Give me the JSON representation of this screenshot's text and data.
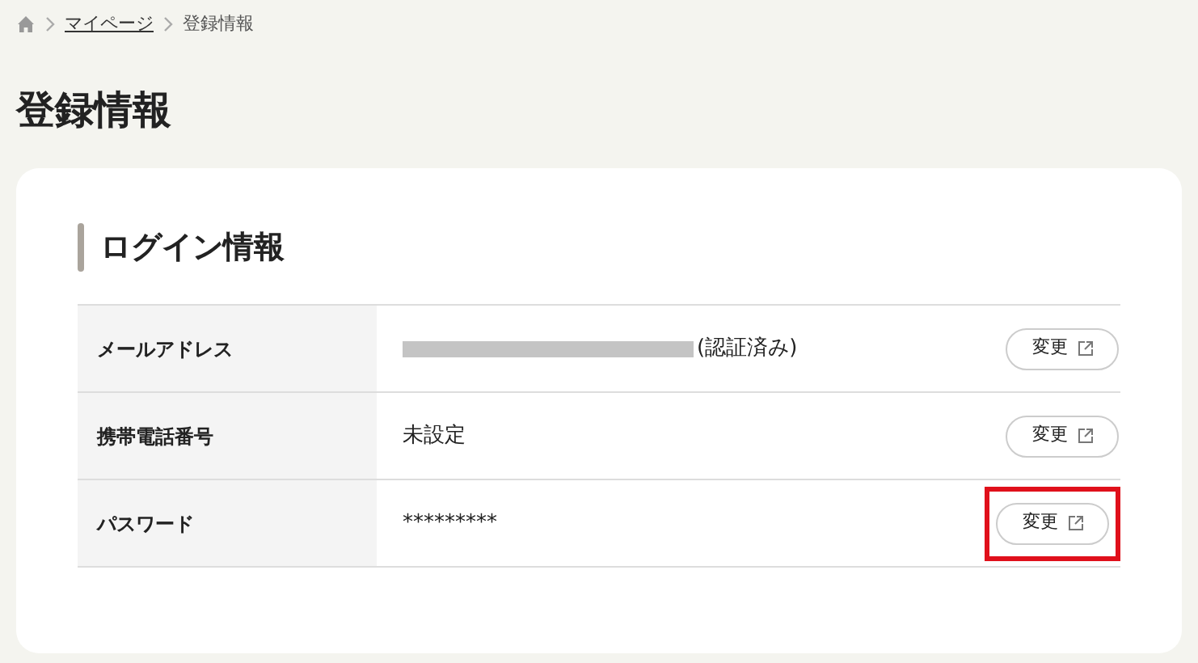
{
  "breadcrumb": [
    {
      "label": "マイページ",
      "link": true
    },
    {
      "label": "登録情報",
      "link": false
    }
  ],
  "title": "登録情報",
  "section": {
    "heading": "ログイン情報",
    "rows": [
      {
        "label": "メールアドレス",
        "value": "(認証済み)",
        "redacted": true,
        "button": "変更",
        "highlighted": false
      },
      {
        "label": "携帯電話番号",
        "value": "未設定",
        "redacted": false,
        "button": "変更",
        "highlighted": false
      },
      {
        "label": "パスワード",
        "value": "*********",
        "redacted": false,
        "button": "変更",
        "highlighted": true
      }
    ]
  }
}
